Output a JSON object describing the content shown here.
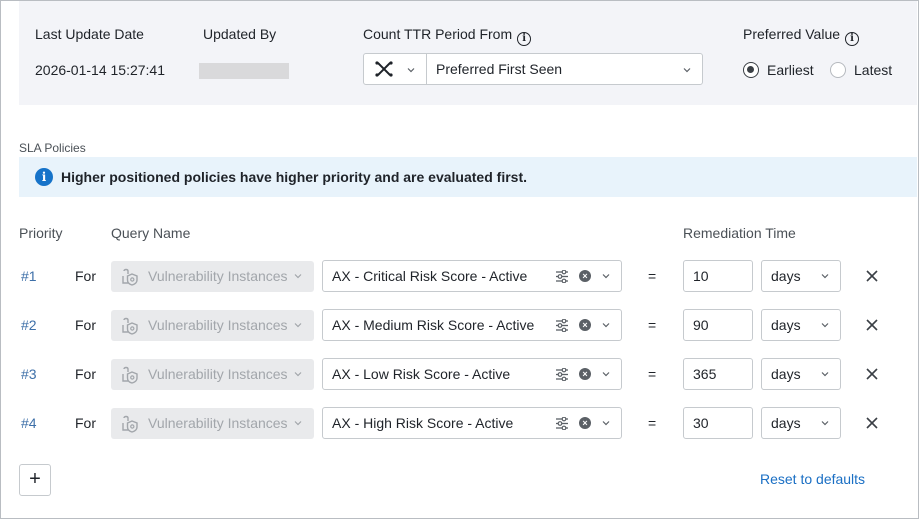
{
  "header": {
    "last_update_label": "Last Update Date",
    "last_update_value": "2026-01-14 15:27:41",
    "updated_by_label": "Updated By",
    "count_ttr_label": "Count TTR Period From",
    "count_ttr_source_icon": "source-x-icon",
    "count_ttr_value": "Preferred First Seen",
    "preferred_value_label": "Preferred Value",
    "preferred_options": [
      {
        "label": "Earliest",
        "checked": true
      },
      {
        "label": "Latest",
        "checked": false
      }
    ]
  },
  "sla": {
    "section_label": "SLA Policies",
    "banner_text": "Higher positioned policies have higher priority and are evaluated first.",
    "columns": {
      "priority": "Priority",
      "query_name": "Query Name",
      "remediation_time": "Remediation Time"
    },
    "rows": [
      {
        "priority": "#1",
        "for": "For",
        "entity": "Vulnerability Instances",
        "query": "AX - Critical Risk Score - Active",
        "equals": "=",
        "time": "10",
        "unit": "days"
      },
      {
        "priority": "#2",
        "for": "For",
        "entity": "Vulnerability Instances",
        "query": "AX - Medium Risk Score - Active",
        "equals": "=",
        "time": "90",
        "unit": "days"
      },
      {
        "priority": "#3",
        "for": "For",
        "entity": "Vulnerability Instances",
        "query": "AX - Low Risk Score - Active",
        "equals": "=",
        "time": "365",
        "unit": "days"
      },
      {
        "priority": "#4",
        "for": "For",
        "entity": "Vulnerability Instances",
        "query": "AX - High Risk Score - Active",
        "equals": "=",
        "time": "30",
        "unit": "days"
      }
    ],
    "add_label": "+",
    "reset_label": "Reset to defaults"
  },
  "colors": {
    "accent": "#1a6fc4",
    "banner_bg": "#e8f3fb",
    "panel_bg": "#f3f4f8"
  }
}
